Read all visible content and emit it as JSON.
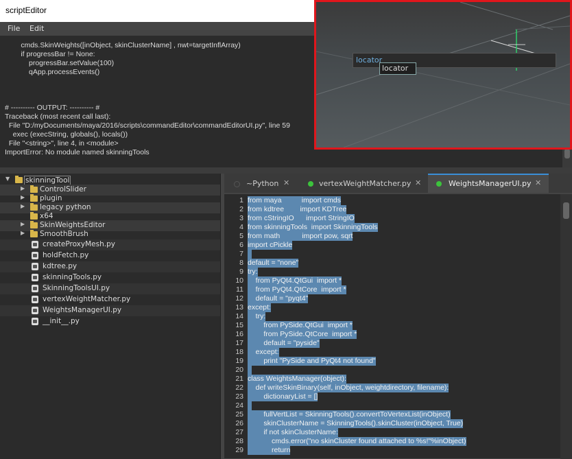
{
  "window": {
    "title": "scriptEditor"
  },
  "menu": [
    "File",
    "Edit"
  ],
  "output_text": "        cmds.SkinWeights([inObject, skinClusterName] , nwt=targetInflArray)\n        if progressBar != None:\n            progressBar.setValue(100)\n            qApp.processEvents()\n\n\n\n# ---------- OUTPUT: ---------- #\nTraceback (most recent call last):\n  File \"D:/myDocuments/maya/2016/scripts\\commandEditor\\commandEditorUI.py\", line 59\n    exec (execString, globals(), locals())\n  File \"<string>\", line 4, in <module>\nImportError: No module named skinningTools",
  "viewport": {
    "popup_label": "locator",
    "popup_item": "locator"
  },
  "tree": [
    {
      "label": "skinningTool",
      "type": "folder",
      "expanded": true
    },
    {
      "label": "ControlSlider",
      "type": "folder",
      "arrow": true
    },
    {
      "label": "plugin",
      "type": "folder",
      "arrow": true
    },
    {
      "label": "legacy python",
      "type": "folder",
      "arrow": true
    },
    {
      "label": "x64",
      "type": "folder",
      "arrow": false
    },
    {
      "label": "SkinWeightsEditor",
      "type": "folder",
      "arrow": true
    },
    {
      "label": "SmoothBrush",
      "type": "folder",
      "arrow": true
    },
    {
      "label": "createProxyMesh.py",
      "type": "file"
    },
    {
      "label": "holdFetch.py",
      "type": "file"
    },
    {
      "label": "kdtree.py",
      "type": "file"
    },
    {
      "label": "skinningTools.py",
      "type": "file"
    },
    {
      "label": "SkinningToolsUI.py",
      "type": "file"
    },
    {
      "label": "vertexWeightMatcher.py",
      "type": "file"
    },
    {
      "label": "WeightsManagerUI.py",
      "type": "file"
    },
    {
      "label": "__init__.py",
      "type": "file"
    }
  ],
  "tabs": [
    {
      "label": "~Python",
      "dot": "#555555",
      "active": false
    },
    {
      "label": "vertexWeightMatcher.py",
      "dot": "#3cc33c",
      "active": false
    },
    {
      "label": "WeightsManagerUI.py",
      "dot": "#3cc33c",
      "active": true
    }
  ],
  "code": [
    "from maya          import cmds",
    "from kdtree        import KDTree",
    "from cStringIO      import StringIO",
    "from skinningTools  import SkinningTools",
    "from math           import pow, sqrt",
    "import cPickle",
    "",
    "default = \"none\"",
    "try:",
    "    from PyQt4.QtGui  import *",
    "    from PyQt4.QtCore  import *",
    "    default = \"pyqt4\"",
    "except:",
    "    try:",
    "        from PySide.QtGui  import *",
    "        from PySide.QtCore  import *",
    "        default = \"pyside\"",
    "    except:",
    "        print \"PySide and PyQt4 not found\"",
    "",
    "class WeightsManager(object):",
    "    def writeSkinBinary(self, inObject, weightdirectory, filename):",
    "        dictionaryList = []",
    "",
    "        fullVertList = SkinningTools().convertToVertexList(inObject)",
    "        skinClusterName = SkinningTools().skinCluster(inObject, True)",
    "        if not skinClusterName:",
    "            cmds.error(\"no skinCluster found attached to %s!\"%inObject)",
    "            return"
  ]
}
